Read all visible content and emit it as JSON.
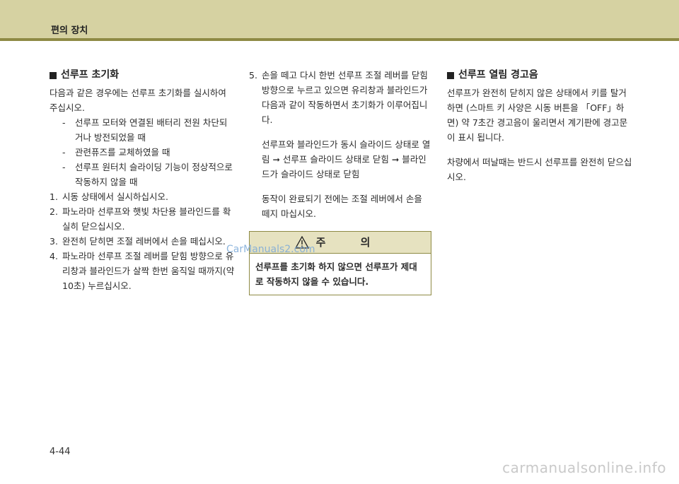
{
  "header": {
    "title": "편의 장치"
  },
  "col1": {
    "title": "선루프 초기화",
    "intro": "다음과 같은 경우에는 선루프 초기화를 실시하여 주십시오.",
    "dashes": [
      "선루프 모터와 연결된 배터리 전원 차단되거나 방전되었을 때",
      "관련퓨즈를 교체하였을 때",
      "선루프 원터치 슬라이딩 기능이 정상적으로 작동하지 않을 때"
    ],
    "steps": [
      {
        "num": "1.",
        "text": "시동 상태에서 실시하십시오."
      },
      {
        "num": "2.",
        "text": "파노라마 선루프와 햇빛 차단용 블라인드를 확실히 닫으십시오."
      },
      {
        "num": "3.",
        "text": "완전히 닫히면 조절 레버에서 손을 떼십시오."
      },
      {
        "num": "4.",
        "text": "파노라마 선루프 조절 레버를 닫힘 방향으로 유리창과 블라인드가 살짝 한번 움직일 때까지(약 10초) 누르십시오."
      }
    ]
  },
  "col2": {
    "step5_num": "5.",
    "step5_text": "손을 떼고 다시 한번 선루프 조절 레버를 닫힘 방향으로 누르고 있으면 유리창과 블라인드가 다음과 같이 작동하면서 초기화가 이루어집니다.",
    "para1": "선루프와 블라인드가 동시 슬라이드 상태로 열림 ➞ 선루프 슬라이드 상태로 닫힘 ➞ 블라인드가 슬라이드 상태로 닫힘",
    "para2": "동작이 완료되기 전에는 조절 레버에서 손을 떼지 마십시오.",
    "caution_title": "주 의",
    "caution_text": "선루프를 초기화 하지 않으면 선루프가 제대로 작동하지 않을 수 있습니다."
  },
  "col3": {
    "title": "선루프 열림 경고음",
    "para1": "선루프가 완전히 닫히지 않은 상태에서 키를 탈거 하면 (스마트 키 사양은 시동 버튼을 「OFF」하면) 약 7초간 경고음이 울리면서 계기판에 경고문이 표시 됩니다.",
    "para2": "차량에서 떠날때는 반드시 선루프를 완전히 닫으십시오."
  },
  "watermark": "CarManuals2.com",
  "page_number": "4-44",
  "site": "carmanualsonline.info"
}
